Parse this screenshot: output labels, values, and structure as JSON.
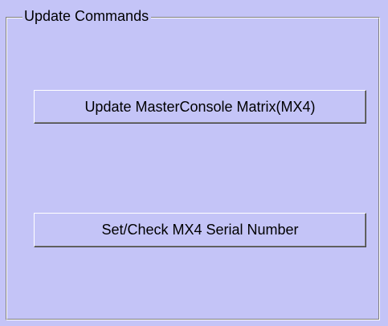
{
  "group": {
    "title": "Update Commands"
  },
  "buttons": {
    "update_matrix": "Update MasterConsole Matrix(MX4)",
    "serial_number": "Set/Check MX4 Serial Number"
  },
  "colors": {
    "background": "#c4c4f7"
  }
}
